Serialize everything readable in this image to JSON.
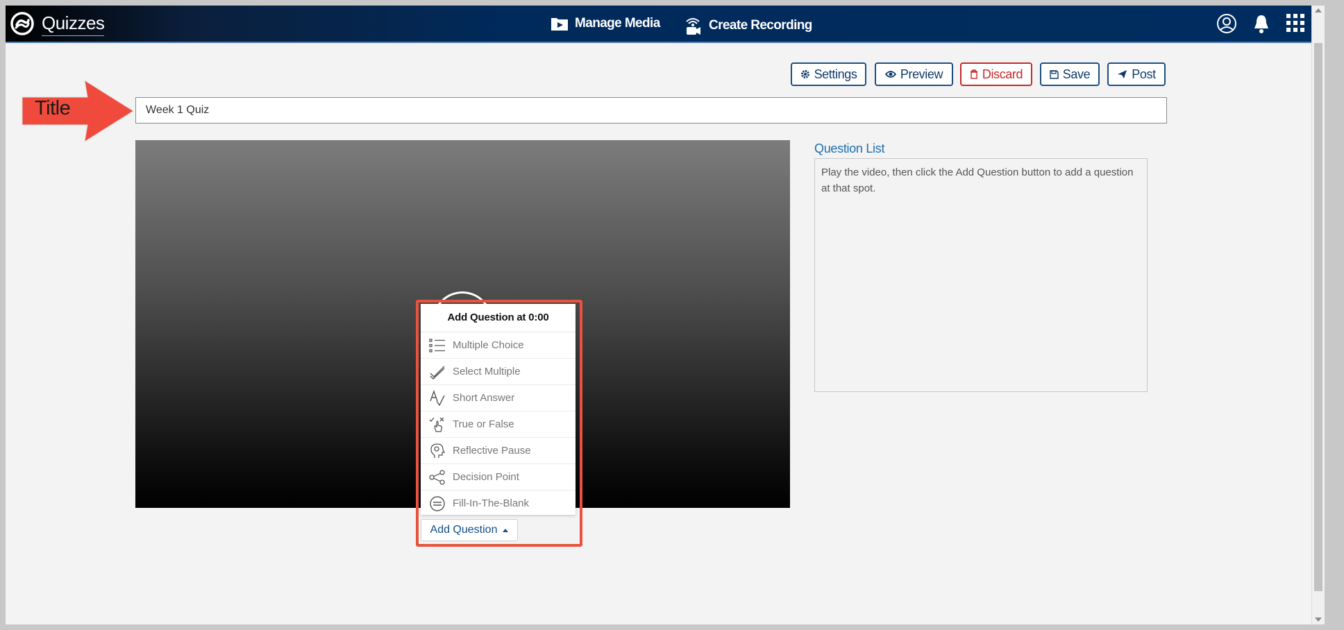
{
  "app": {
    "brand": "Quizzes"
  },
  "nav": {
    "manage_media": "Manage Media",
    "create_recording": "Create Recording"
  },
  "toolbar": {
    "settings": "Settings",
    "preview": "Preview",
    "discard": "Discard",
    "save": "Save",
    "post": "Post"
  },
  "title_field": {
    "value": "Week 1 Quiz"
  },
  "annotation": {
    "label": "Title"
  },
  "question_list": {
    "heading": "Question List",
    "placeholder": "Play the video, then click the Add Question button to add a question at that spot."
  },
  "add_question_menu": {
    "header": "Add Question at 0:00",
    "items": [
      {
        "label": "Multiple Choice",
        "icon": "list-icon"
      },
      {
        "label": "Select Multiple",
        "icon": "double-check-icon"
      },
      {
        "label": "Short Answer",
        "icon": "handwriting-icon"
      },
      {
        "label": "True or False",
        "icon": "check-cross-pointer-icon"
      },
      {
        "label": "Reflective Pause",
        "icon": "head-thought-icon"
      },
      {
        "label": "Decision Point",
        "icon": "share-nodes-icon"
      },
      {
        "label": "Fill-In-The-Blank",
        "icon": "blank-lines-icon"
      }
    ],
    "button_label": "Add Question"
  },
  "colors": {
    "topbar": "#002d60",
    "accent": "#1c4e80",
    "danger": "#c62828",
    "callout": "#e8533d"
  }
}
